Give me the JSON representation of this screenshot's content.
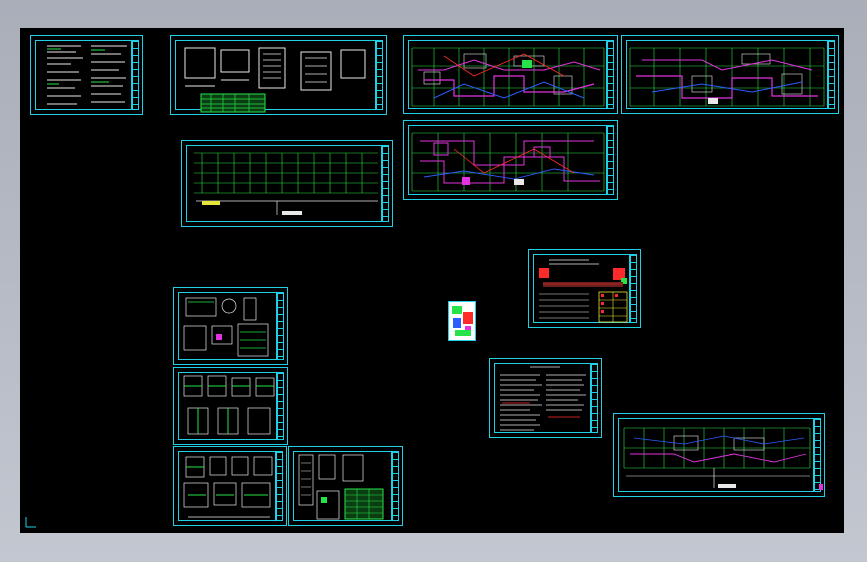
{
  "colors": {
    "background_top": "#a9aeb9",
    "background_bottom": "#c3c7d0",
    "canvas": "#000000",
    "sheet_border": "#1fd0e6",
    "grid_green": "#27e34a",
    "pipe_magenta": "#e233e0",
    "pipe_red": "#ff2b2b",
    "pipe_blue": "#2b5dff",
    "text_white": "#e8e8e8",
    "yellow": "#e8e53a"
  },
  "icons": [
    "drawing-sheet-icon",
    "ucs-marker-icon"
  ],
  "sheets": [
    {
      "name": "sheet-general-notes-1"
    },
    {
      "name": "sheet-equipment-list"
    },
    {
      "name": "sheet-floor-plan-a"
    },
    {
      "name": "sheet-floor-plan-b"
    },
    {
      "name": "sheet-elevation"
    },
    {
      "name": "sheet-floor-plan-c"
    },
    {
      "name": "sheet-legend-red"
    },
    {
      "name": "sheet-preview-thumbnail"
    },
    {
      "name": "sheet-details-1"
    },
    {
      "name": "sheet-details-2"
    },
    {
      "name": "sheet-details-3"
    },
    {
      "name": "sheet-details-4"
    },
    {
      "name": "sheet-notes-text"
    },
    {
      "name": "sheet-floor-plan-d"
    }
  ]
}
